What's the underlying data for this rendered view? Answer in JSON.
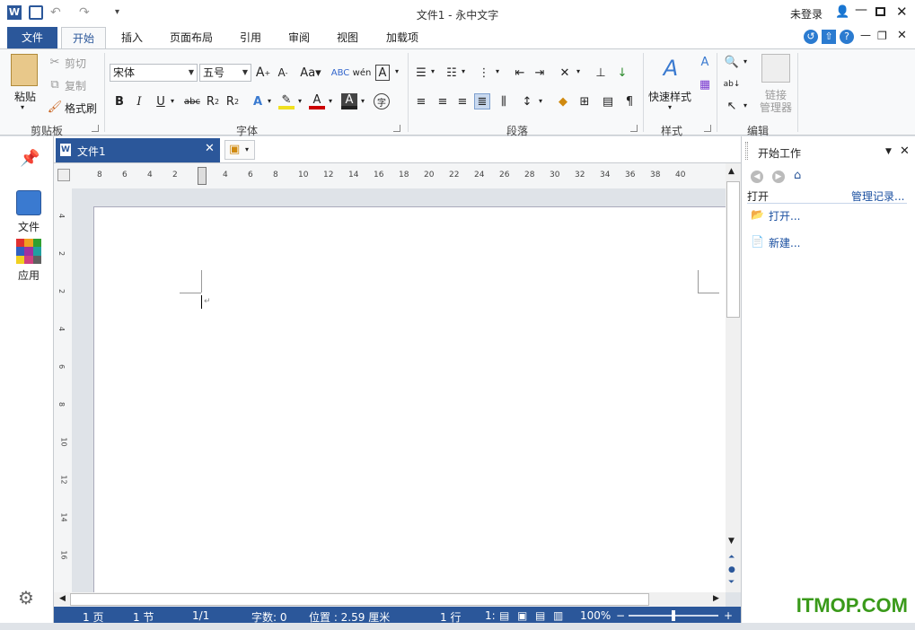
{
  "window": {
    "title": "文件1 - 永中文字",
    "login": "未登录"
  },
  "ribbon_tabs": [
    "文件",
    "开始",
    "插入",
    "页面布局",
    "引用",
    "审阅",
    "视图",
    "加载项"
  ],
  "clipboard": {
    "paste": "粘贴",
    "cut": "剪切",
    "copy": "复制",
    "format_painter": "格式刷",
    "group": "剪贴板"
  },
  "font": {
    "name": "宋体",
    "size": "五号",
    "group": "字体"
  },
  "paragraph": {
    "group": "段落"
  },
  "styles": {
    "quick": "快速样式",
    "group": "样式"
  },
  "editing": {
    "link_manager": "链接\n管理器",
    "group": "编辑"
  },
  "left_nav": {
    "file": "文件",
    "apps": "应用"
  },
  "doc_tab": {
    "title": "文件1"
  },
  "ruler_h": [
    "8",
    "6",
    "4",
    "2",
    "2",
    "4",
    "6",
    "8",
    "10",
    "12",
    "14",
    "16",
    "18",
    "20",
    "22",
    "24",
    "26",
    "28",
    "30",
    "32",
    "34",
    "36",
    "38",
    "40"
  ],
  "ruler_v": [
    "4",
    "2",
    "2",
    "4",
    "6",
    "8",
    "10",
    "12",
    "14",
    "16"
  ],
  "status": {
    "page": "1 页",
    "section": "1 节",
    "pages": "1/1",
    "words": "字数: 0",
    "position": "位置 : 2.59 厘米",
    "line": "1 行",
    "col": "1:",
    "zoom": "100%"
  },
  "pane": {
    "title": "开始工作",
    "open_label": "打开",
    "manage": "管理记录...",
    "open_link": "打开...",
    "new_link": "新建..."
  },
  "watermark": "ITMOP.COM",
  "colors": {
    "accent": "#2b579a",
    "watermark": "#3a9a1a"
  }
}
